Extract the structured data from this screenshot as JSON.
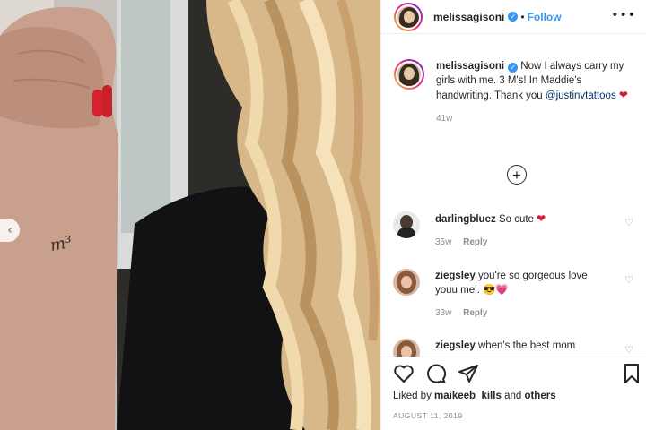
{
  "header": {
    "username": "melissagisoni",
    "separator": "•",
    "follow_label": "Follow"
  },
  "caption": {
    "username": "melissagisoni",
    "text": "Now I always carry my girls with me. 3 M's! In Maddie's handwriting. Thank you",
    "mention": "@justinvtattoos",
    "emoji": "❤",
    "time": "41w"
  },
  "load_more_label": "+",
  "comments": [
    {
      "username": "darlingbluez",
      "text": "So cute",
      "emoji": "❤",
      "time": "35w",
      "reply_label": "Reply"
    },
    {
      "username": "ziegsley",
      "text": "you're so gorgeous love youu mel.",
      "emoji": "😎💗",
      "time": "33w",
      "reply_label": "Reply"
    },
    {
      "username": "ziegsley",
      "text": "when's the best mom",
      "emoji": "",
      "time": "",
      "reply_label": ""
    }
  ],
  "likes": {
    "prefix": "Liked by",
    "user": "maikeeb_kills",
    "conjunction": "and",
    "others": "others"
  },
  "post_date": "AUGUST 11, 2019",
  "photo": {
    "tattoo_text": "m³"
  },
  "icons": {
    "verified": "verified-badge-icon",
    "more": "more-options-icon",
    "like": "heart-icon",
    "comment": "comment-icon",
    "share": "share-icon",
    "save": "bookmark-icon",
    "prev": "chevron-left-icon",
    "load_more": "plus-circle-icon"
  },
  "colors": {
    "accent": "#3897f0",
    "heart": "#d11b3a",
    "muted": "#8e8e8e",
    "text": "#262626"
  }
}
